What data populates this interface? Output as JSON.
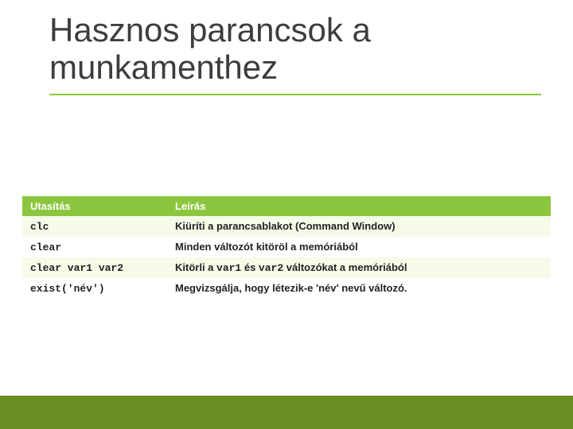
{
  "title_line1": "Hasznos parancsok a",
  "title_line2": "munkamenthez",
  "headers": {
    "cmd": "Utasítás",
    "desc": "Leírás"
  },
  "rows": [
    {
      "cmd": "clc",
      "desc_pre": "Kiüríti a parancsablakot (Command Window)",
      "mono1": "",
      "desc_mid": "",
      "mono2": "",
      "desc_post": ""
    },
    {
      "cmd": "clear",
      "desc_pre": "Minden változót kitöröl a memóriából",
      "mono1": "",
      "desc_mid": "",
      "mono2": "",
      "desc_post": ""
    },
    {
      "cmd": "clear var1 var2",
      "desc_pre": "Kitörli a ",
      "mono1": "var1",
      "desc_mid": " és ",
      "mono2": "var2",
      "desc_post": " változókat a memóriából"
    },
    {
      "cmd": "exist('név')",
      "desc_pre": "Megvizsgálja, hogy létezik-e  'név' nevű változó.",
      "mono1": "",
      "desc_mid": "",
      "mono2": "",
      "desc_post": ""
    }
  ],
  "colors": {
    "accent": "#8cc63f",
    "footer": "#6b8e23"
  }
}
